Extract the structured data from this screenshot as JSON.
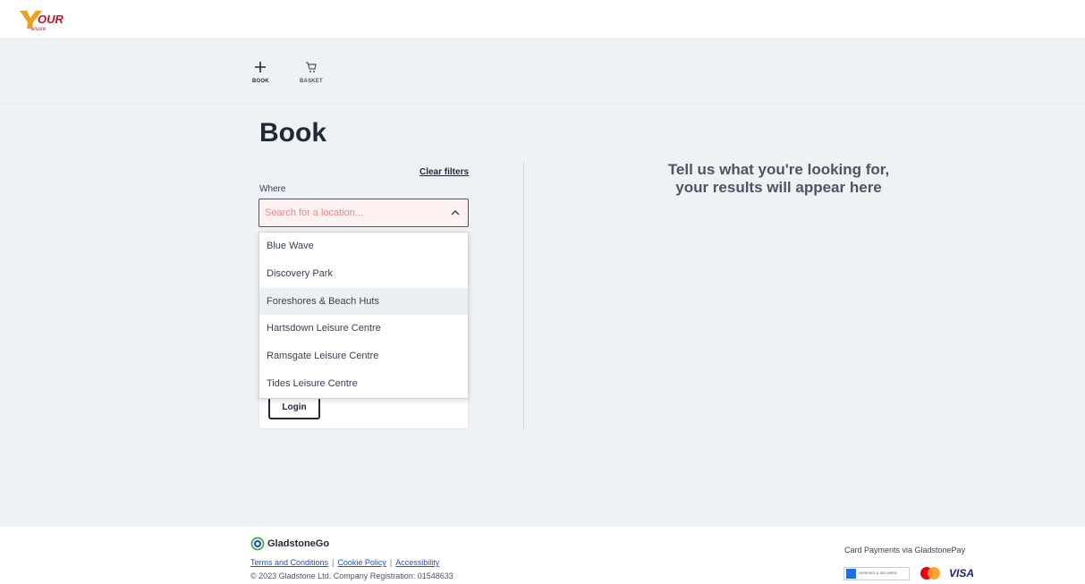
{
  "brand": {
    "logo_alt": "Your Leisure",
    "accent": "#f0a020",
    "logo_red": "#c8102e"
  },
  "nav": {
    "book_label": "BOOK",
    "basket_label": "BASKET",
    "book_icon": "plus-icon",
    "basket_icon": "cart-icon"
  },
  "page": {
    "title": "Book"
  },
  "filters": {
    "clear_label": "Clear filters",
    "where_label": "Where",
    "search_placeholder": "Search for a location...",
    "options": [
      "Blue Wave",
      "Discovery Park",
      "Foreshores & Beach Huts",
      "Hartsdown Leisure Centre",
      "Ramsgate Leisure Centre",
      "Tides Leisure Centre"
    ],
    "hovered_option": "Foreshores & Beach Huts"
  },
  "auth": {
    "login_label": "Login"
  },
  "results": {
    "line1": "Tell us what you're looking for,",
    "line2": "your results will appear here"
  },
  "footer": {
    "brand": "GladstoneGo",
    "links": [
      "Terms and Conditions",
      "Cookie Policy",
      "Accessibility"
    ],
    "copyright": "© 2023 Gladstone Ltd. Company Registration: 01548633",
    "payments_label": "Card Payments via GladstonePay",
    "verified_text": "VERIFIED & SECURED",
    "visa_text": "VISA"
  }
}
